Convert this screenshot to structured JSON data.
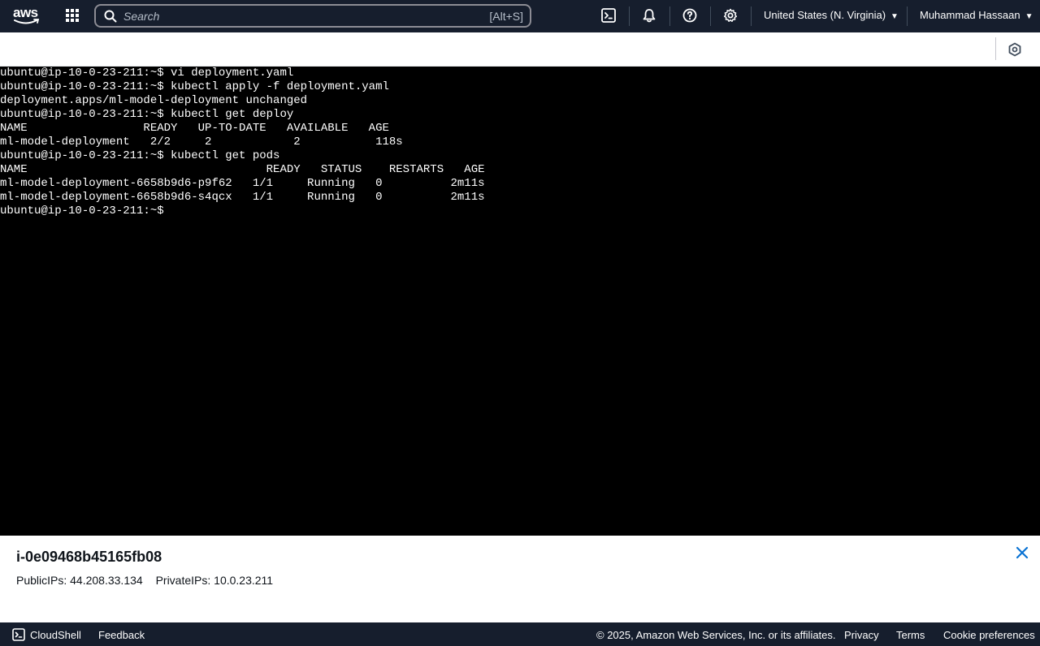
{
  "topnav": {
    "logo_text": "aws",
    "search_placeholder": "Search",
    "search_shortcut": "[Alt+S]",
    "region": "United States (N. Virginia)",
    "user": "Muhammad Hassaan"
  },
  "terminal": {
    "lines": [
      "ubuntu@ip-10-0-23-211:~$ vi deployment.yaml",
      "ubuntu@ip-10-0-23-211:~$ kubectl apply -f deployment.yaml",
      "deployment.apps/ml-model-deployment unchanged",
      "ubuntu@ip-10-0-23-211:~$ kubectl get deploy",
      "NAME                 READY   UP-TO-DATE   AVAILABLE   AGE",
      "ml-model-deployment   2/2     2            2           118s",
      "ubuntu@ip-10-0-23-211:~$ kubectl get pods",
      "NAME                                   READY   STATUS    RESTARTS   AGE",
      "ml-model-deployment-6658b9d6-p9f62   1/1     Running   0          2m11s",
      "ml-model-deployment-6658b9d6-s4qcx   1/1     Running   0          2m11s",
      "ubuntu@ip-10-0-23-211:~$"
    ]
  },
  "instance": {
    "id": "i-0e09468b45165fb08",
    "public_ips_label": "PublicIPs:",
    "public_ips": "44.208.33.134",
    "private_ips_label": "PrivateIPs:",
    "private_ips": "10.0.23.211"
  },
  "footer": {
    "cloudshell": "CloudShell",
    "feedback": "Feedback",
    "copyright": "© 2025, Amazon Web Services, Inc. or its affiliates.",
    "privacy": "Privacy",
    "terms": "Terms",
    "cookie": "Cookie preferences"
  },
  "colors": {
    "nav_bg": "#161e2d",
    "terminal_bg": "#000000",
    "accent_blue": "#0972d3"
  }
}
